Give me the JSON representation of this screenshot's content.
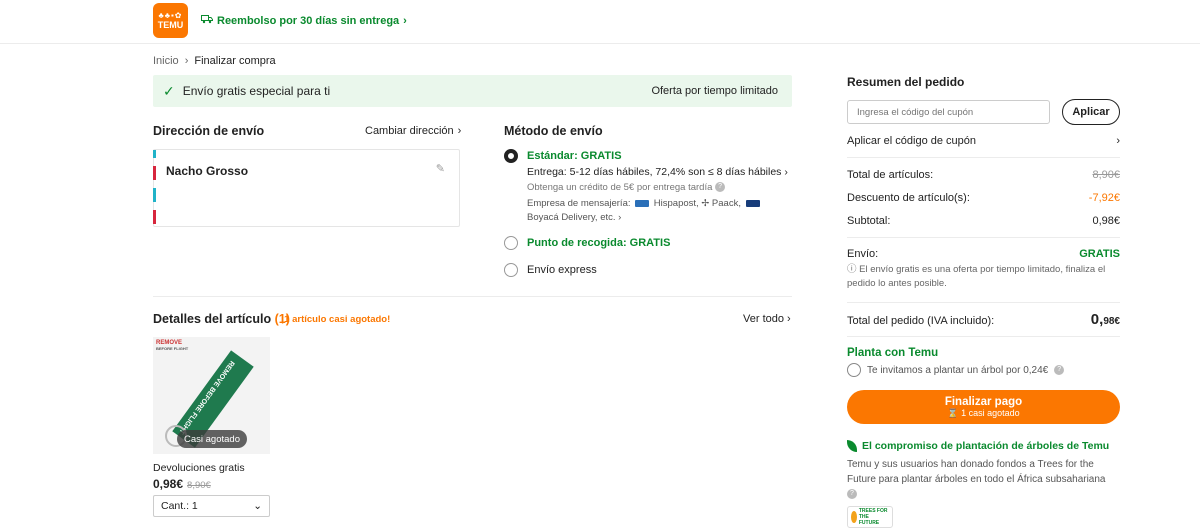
{
  "header": {
    "logo_mark": "♣♣▪✿",
    "logo_text": "TEMU",
    "refund_text": "Reembolso por 30 días sin entrega",
    "refund_chevron": "›"
  },
  "breadcrumb": {
    "home": "Inicio",
    "sep": "›",
    "current": "Finalizar compra"
  },
  "promo": {
    "check": "✓",
    "text": "Envío gratis especial para ti",
    "right": "Oferta por tiempo limitado"
  },
  "address": {
    "title": "Dirección de envío",
    "change": "Cambiar dirección",
    "chevron": "›",
    "name": "Nacho Grosso",
    "edit_icon": "✎"
  },
  "shipping": {
    "title": "Método de envío",
    "standard_label": "Estándar: GRATIS",
    "delivery": "Entrega: 5-12 días hábiles, 72,4% son ≤ 8 días hábiles",
    "delivery_chevron": "›",
    "credit": "Obtenga un crédito de 5€ por entrega tardía",
    "carriers_prefix": "Empresa de mensajería:",
    "carrier_1": "Hispapost,",
    "carrier_2": "Paack,",
    "carrier_3": "Boyacá Delivery,  etc.",
    "carriers_chevron": "›",
    "pickup_label": "Punto de recogida: GRATIS",
    "express_label": "Envío express"
  },
  "items": {
    "title": "Detalles del artículo",
    "count": "(1)",
    "low_stock": "¡1 artículo casi agotado!",
    "see_all": "Ver todo",
    "chevron": "›",
    "product_brand": "REMOVE",
    "product_brand_sub": "BEFORE FLIGHT",
    "product_tag_text": "REMOVE BEFORE FLIGHT",
    "stock_badge": "Casi agotado",
    "free_returns": "Devoluciones gratis",
    "price": "0,98€",
    "old_price": "8,90€",
    "qty_label": "Cant.: 1",
    "qty_chevron": "⌄"
  },
  "summary": {
    "title": "Resumen del pedido",
    "coupon_placeholder": "Ingresa el código del cupón",
    "apply": "Aplicar",
    "coupon_link": "Aplicar el código de cupón",
    "coupon_chevron": "›",
    "total_items_label": "Total de artículos:",
    "total_items_value": "8,90€",
    "discount_label": "Descuento de artículo(s):",
    "discount_value": "-7,92€",
    "subtotal_label": "Subtotal:",
    "subtotal_value": "0,98€",
    "shipping_label": "Envío:",
    "shipping_value": "GRATIS",
    "shipping_note": "ⓘ El envío gratis es una oferta por tiempo limitado, finaliza el pedido lo antes posible.",
    "order_total_label": "Total del pedido (IVA incluido):",
    "order_total_int": "0,",
    "order_total_dec": "98€"
  },
  "plant": {
    "title": "Planta con Temu",
    "invite": "Te invitamos a plantar un árbol por 0,24€",
    "info": "?"
  },
  "pay": {
    "label": "Finalizar pago",
    "sub": "⌛ 1 casi agotado"
  },
  "commitment": {
    "title": "El compromiso de plantación de árboles de Temu",
    "text": "Temu y sus usuarios han donado fondos a Trees for the Future para plantar árboles en todo el África subsahariana",
    "info": "?",
    "badge": "TREES FOR THE FUTURE"
  },
  "colors": {
    "brand": "#fb7701",
    "success": "#0a8a2e"
  }
}
